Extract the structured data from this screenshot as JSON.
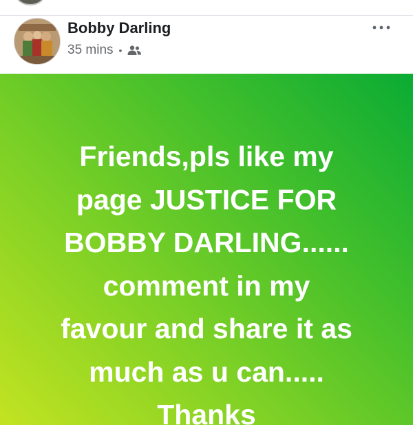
{
  "post": {
    "author": "Bobby Darling",
    "time": "35 mins",
    "separator": "•",
    "audience_icon": "friends-icon",
    "more_icon": "more-options-icon",
    "body_lines": [
      "Friends,pls like my",
      "page JUSTICE FOR",
      "BOBBY DARLING......",
      "comment in my",
      "favour and share it as",
      "much as u can.....",
      "Thanks"
    ],
    "background_colors": [
      "#0aab34",
      "#78cf26",
      "#c3e321"
    ]
  }
}
